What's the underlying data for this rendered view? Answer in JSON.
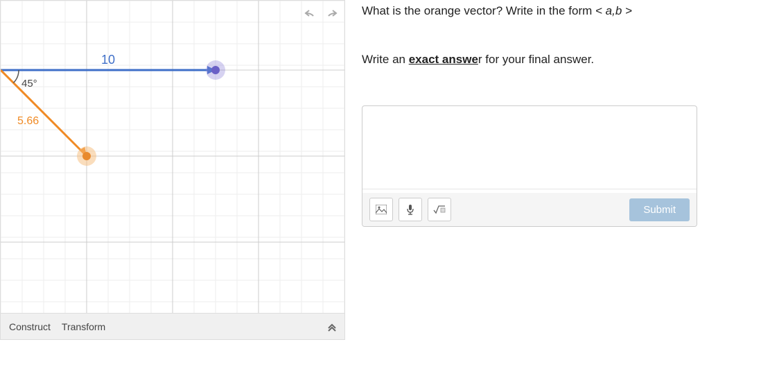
{
  "graph": {
    "blue_vector_label": "10",
    "angle_label": "45°",
    "orange_vector_label": "5.66",
    "toolbar": {
      "construct": "Construct",
      "transform": "Transform"
    }
  },
  "question": {
    "line1_prefix": "What is the orange vector?  Write in the form  ",
    "line1_math": "< a,b >",
    "line2_prefix": "Write an ",
    "line2_emph": "exact answe",
    "line2_suffix": "r for your final answer."
  },
  "answer": {
    "value": "",
    "submit_label": "Submit"
  },
  "chart_data": {
    "type": "vector-diagram",
    "origin": [
      0,
      0
    ],
    "vectors": [
      {
        "name": "blue",
        "color": "#3f6fc8",
        "magnitude": 10,
        "angle_deg": 0,
        "endpoint": [
          10,
          0
        ]
      },
      {
        "name": "orange",
        "color": "#f08a24",
        "magnitude": 5.66,
        "angle_deg": -45,
        "endpoint": [
          4,
          -4
        ]
      }
    ],
    "angle_between_label": "45°",
    "grid_spacing": 1
  }
}
